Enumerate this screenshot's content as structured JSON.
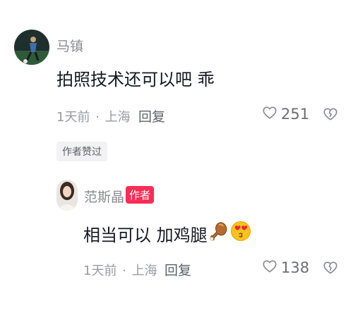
{
  "comment": {
    "username": "马镇",
    "text": "拍照技术还可以吧 乖",
    "time": "1天前",
    "separator": "·",
    "location": "上海",
    "reply_label": "回复",
    "like_count": "251",
    "author_liked_chip": "作者赞过"
  },
  "reply": {
    "username": "范斯晶",
    "badge": "作者",
    "text": "相当可以 加鸡腿",
    "emojis": [
      "poultry-leg-emoji",
      "heart-eyes-emoji"
    ],
    "time": "1天前",
    "separator": "·",
    "location": "上海",
    "reply_label": "回复",
    "like_count": "138"
  },
  "colors": {
    "accent": "#fe2c55",
    "text_primary": "#161823",
    "text_secondary": "#8a8b91"
  }
}
